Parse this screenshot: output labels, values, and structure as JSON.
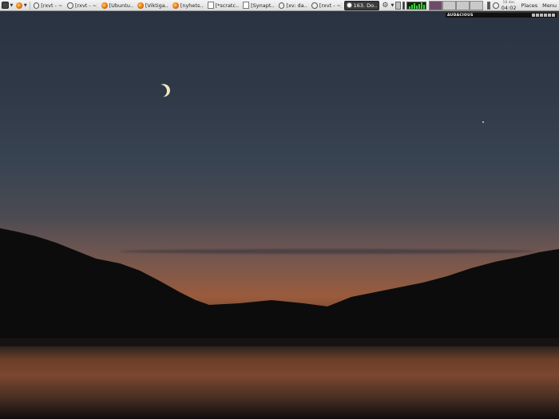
{
  "panel": {
    "tasks": [
      {
        "icon": "globe-icon",
        "label": "[rxvt - ~]"
      },
      {
        "icon": "globe-icon",
        "label": "[rxvt - ~]"
      },
      {
        "icon": "firefox-icon",
        "label": "[Ubuntu..."
      },
      {
        "icon": "firefox-icon",
        "label": "[Viktiga..."
      },
      {
        "icon": "firefox-icon",
        "label": "[nyhets..."
      },
      {
        "icon": "document-icon",
        "label": "[*scratc..."
      },
      {
        "icon": "document-icon",
        "label": "[Synapt..."
      },
      {
        "icon": "globe-icon",
        "label": "[xv: da..."
      },
      {
        "icon": "globe-icon",
        "label": "[rxvt - ~]"
      },
      {
        "icon": "badge-icon",
        "label": "163. Do...",
        "active": true
      }
    ],
    "clock": {
      "date": "18 dec",
      "time": "04:02"
    },
    "places_label": "Places",
    "menu_label": "Menu"
  },
  "audacious": {
    "title": "AUDACIOUS"
  },
  "colors": {
    "panel": "#e6e6e6",
    "active_task": "#3b3b3b",
    "workspace_current": "#6f4b6a",
    "cpu_graph": "#39d139"
  }
}
